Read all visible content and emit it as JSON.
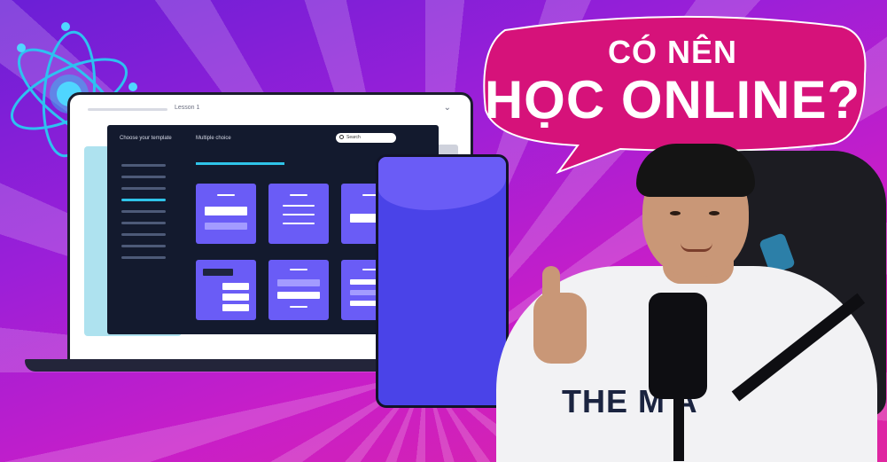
{
  "laptop": {
    "lesson_title": "Lesson 1",
    "sidebar_heading": "Choose your template",
    "main_heading": "Multiple choice",
    "search_placeholder": "Search"
  },
  "bubble": {
    "line1": "CÓ NÊN",
    "line2": "HỌC ONLINE?"
  },
  "shirt_logo": "THE M  A",
  "colors": {
    "bubble": "#d6127a",
    "card": "#6a5cf6",
    "phone": "#4a43e8",
    "accent": "#2fc3e8"
  },
  "icons": [
    "atom-icon",
    "search-icon",
    "chevron-down-icon"
  ]
}
